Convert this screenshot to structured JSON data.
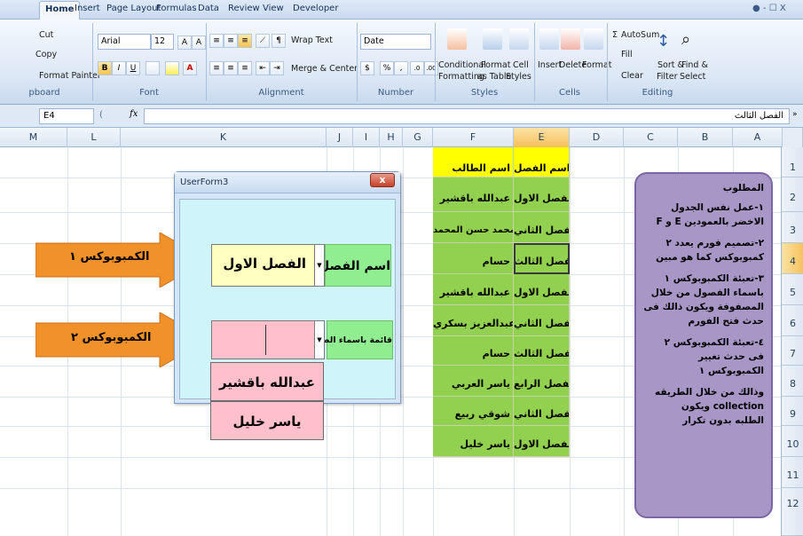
{
  "ribbon": {
    "tabs": [
      "Home",
      "Insert",
      "Page Layout",
      "Formulas",
      "Data",
      "Review",
      "View",
      "Developer"
    ],
    "clipboard": {
      "cut": "Cut",
      "copy": "Copy",
      "format_painter": "Format Painter",
      "group": "pboard"
    },
    "font": {
      "name": "Arial",
      "size": "12",
      "bold": "B",
      "italic": "I",
      "underline": "U",
      "group": "Font",
      "grow": "A",
      "shrink": "A",
      "font_color": "A"
    },
    "alignment": {
      "wrap_text": "Wrap Text",
      "merge_center": "Merge & Center",
      "group": "Alignment"
    },
    "number": {
      "format": "Date",
      "percent": "%",
      "comma": ",",
      "group": "Number",
      "inc": ".0",
      "dec": ".00"
    },
    "styles": {
      "conditional": "Conditional",
      "formatting": "Formatting",
      "format_as": "Format",
      "as_table": "as Table",
      "cell": "Cell",
      "styles": "Styles",
      "group": "Styles"
    },
    "cells": {
      "insert": "Insert",
      "delete": "Delete",
      "format": "Format",
      "group": "Cells"
    },
    "editing": {
      "autosum": "AutoSum",
      "fill": "Fill",
      "clear": "Clear",
      "sort": "Sort &",
      "filter": "Filter",
      "find": "Find &",
      "select": "Select",
      "group": "Editing"
    },
    "window_controls": "● - ☐ X"
  },
  "formula_bar": {
    "name_box": "E4",
    "fx": "fx",
    "value": "الفصل الثالث",
    "paren": "("
  },
  "columns": [
    "M",
    "L",
    "K",
    "J",
    "I",
    "H",
    "G",
    "F",
    "E",
    "D",
    "C",
    "B",
    "A"
  ],
  "rows": [
    "1",
    "2",
    "3",
    "4",
    "5",
    "6",
    "7",
    "8",
    "9",
    "10",
    "11",
    "12"
  ],
  "table": {
    "header_student": "اسم الطالب",
    "header_class": "اسم الفصل",
    "rows": [
      {
        "student": "عبدالله باقشير",
        "class": "الفصل الاول"
      },
      {
        "student": "محمد حسن المحمد",
        "class": "الفصل الثاني"
      },
      {
        "student": "حسام",
        "class": "الفصل الثالث"
      },
      {
        "student": "عبدالله باقشير",
        "class": "الفصل الاول"
      },
      {
        "student": "عبدالعزيز بسكري",
        "class": "الفصل الثاني"
      },
      {
        "student": "حسام",
        "class": "الفصل الثالث"
      },
      {
        "student": "ياسر العربي",
        "class": "الفصل الرابع"
      },
      {
        "student": "شوقي ربيع",
        "class": "الفصل الثاني"
      },
      {
        "student": "ياسر خليل",
        "class": "الفصل الاول"
      }
    ]
  },
  "note": {
    "lines": [
      "المطلوب",
      "١-عمل نفس الجدول",
      "الاخضر بالعمودين E و F",
      "",
      "٢-تصميم فورم يعدد ٢",
      "كمبوبوكس كما هو مبين",
      "",
      "٣-تعبئة الكمبوبوكس ١",
      "باسماء الفصول من خلال",
      "المصفوفة ويكون ذالك فى",
      "حدث فتح الفورم",
      "",
      "٤-تعبئة الكمبوبوكس ٢",
      "فى حدث تغيير",
      "الكمبوبوكس ١",
      "",
      "وذالك من خلال الطريقه",
      "collection ويكون",
      "الطلبه بدون تكرار"
    ]
  },
  "arrows": {
    "combo1": "الكمبوبوكس ١",
    "combo2": "الكمبوبوكس ٢"
  },
  "form": {
    "title": "UserForm3",
    "close": "x",
    "label_class": "اسم الفصل",
    "combo1_value": "الفصل الاول",
    "label_students": "قائمة باسماء الطلبه",
    "combo2_value": "",
    "list_items": [
      "عبدالله باقشير",
      "ياسر خليل"
    ]
  },
  "colors": {
    "header_yellow": "#ffff00",
    "data_green": "#92d050",
    "note_purple": "#a897c6",
    "arrow_orange": "#f0912a",
    "form_body": "#cff5fa",
    "combo_yellow": "#ffffc0",
    "list_pink": "#ffc0cb"
  }
}
